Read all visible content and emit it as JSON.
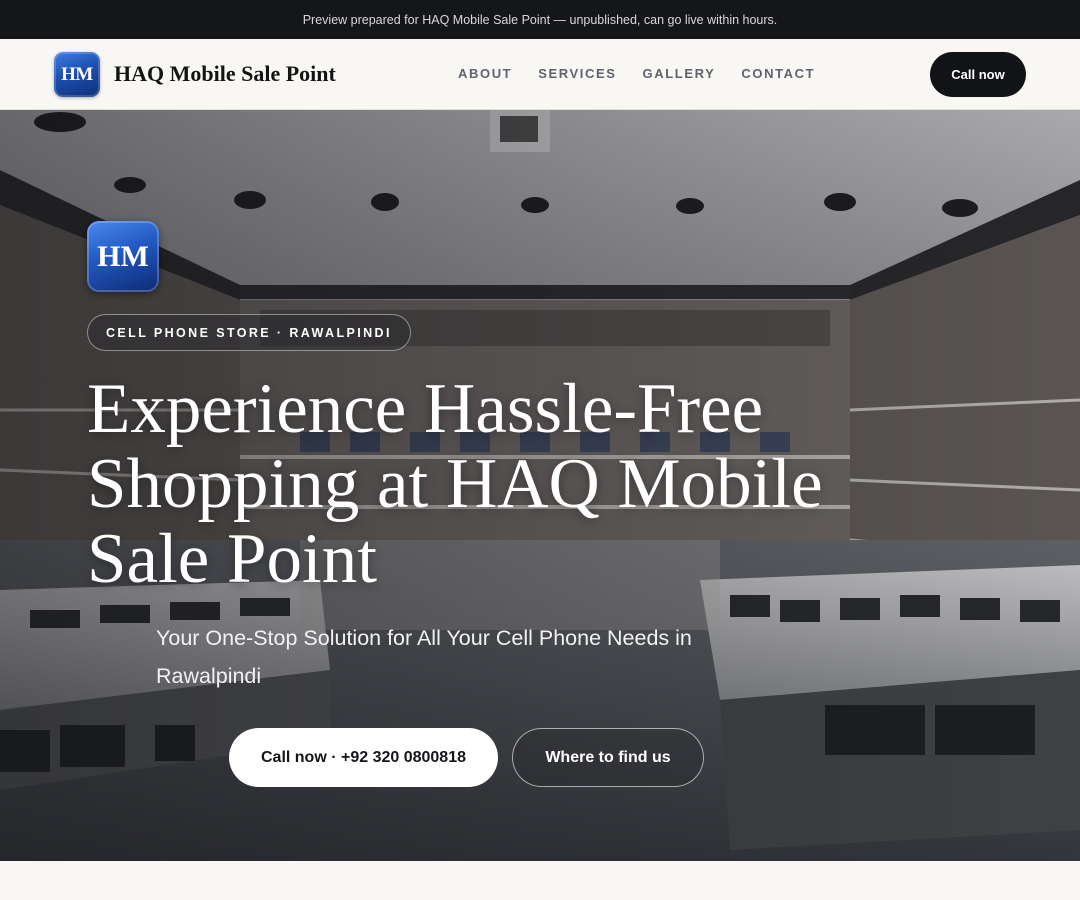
{
  "preview_banner": "Preview prepared for HAQ Mobile Sale Point — unpublished, can go live within hours.",
  "header": {
    "logo_initials": "HM",
    "brand_name": "HAQ Mobile Sale Point",
    "nav": [
      {
        "label": "ABOUT"
      },
      {
        "label": "SERVICES"
      },
      {
        "label": "GALLERY"
      },
      {
        "label": "CONTACT"
      }
    ],
    "cta_label": "Call now"
  },
  "hero": {
    "logo_initials": "HM",
    "eyebrow": "CELL PHONE STORE · RAWALPINDI",
    "title": "Experience Hassle-Free Shopping at HAQ Mobile Sale Point",
    "subtitle": "Your One-Stop Solution for All Your Cell Phone Needs in Rawalpindi",
    "primary_button": "Call now · +92 320 0800818",
    "secondary_button": "Where to find us",
    "background_image": "cell-phone-store-interior"
  },
  "colors": {
    "banner_bg": "#15161a",
    "nav_bg": "#f8f7f4",
    "cta_bg": "#121317",
    "logo_blue": "#1d4fb0"
  }
}
